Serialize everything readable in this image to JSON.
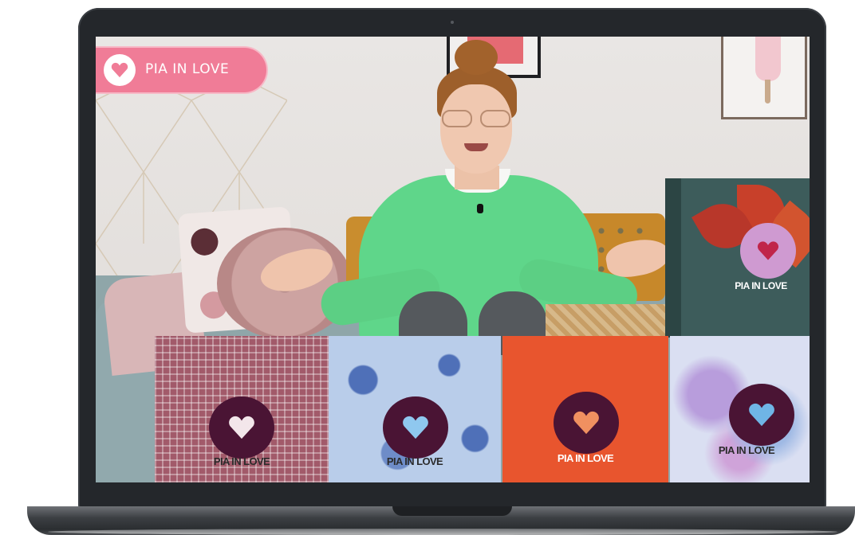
{
  "video": {
    "channel_badge": {
      "name": "PIA IN LOVE",
      "icon": "heart-icon",
      "color": "#f07c97"
    },
    "boxes": [
      {
        "label": "PIA IN LOVE",
        "color": "#a25a6a",
        "pattern": "mosaic"
      },
      {
        "label": "PIA IN LOVE",
        "color": "#b9cdea",
        "pattern": "paisley"
      },
      {
        "label": "PIA IN LOVE",
        "color": "#e8552e",
        "pattern": "solid"
      },
      {
        "label": "PIA IN LOVE",
        "color": "#dadff2",
        "pattern": "watercolor"
      }
    ],
    "large_box": {
      "label": "PIA IN LOVE",
      "color": "#3d5c5b"
    }
  },
  "device": {
    "type": "laptop",
    "bezel_color": "#24272b"
  }
}
